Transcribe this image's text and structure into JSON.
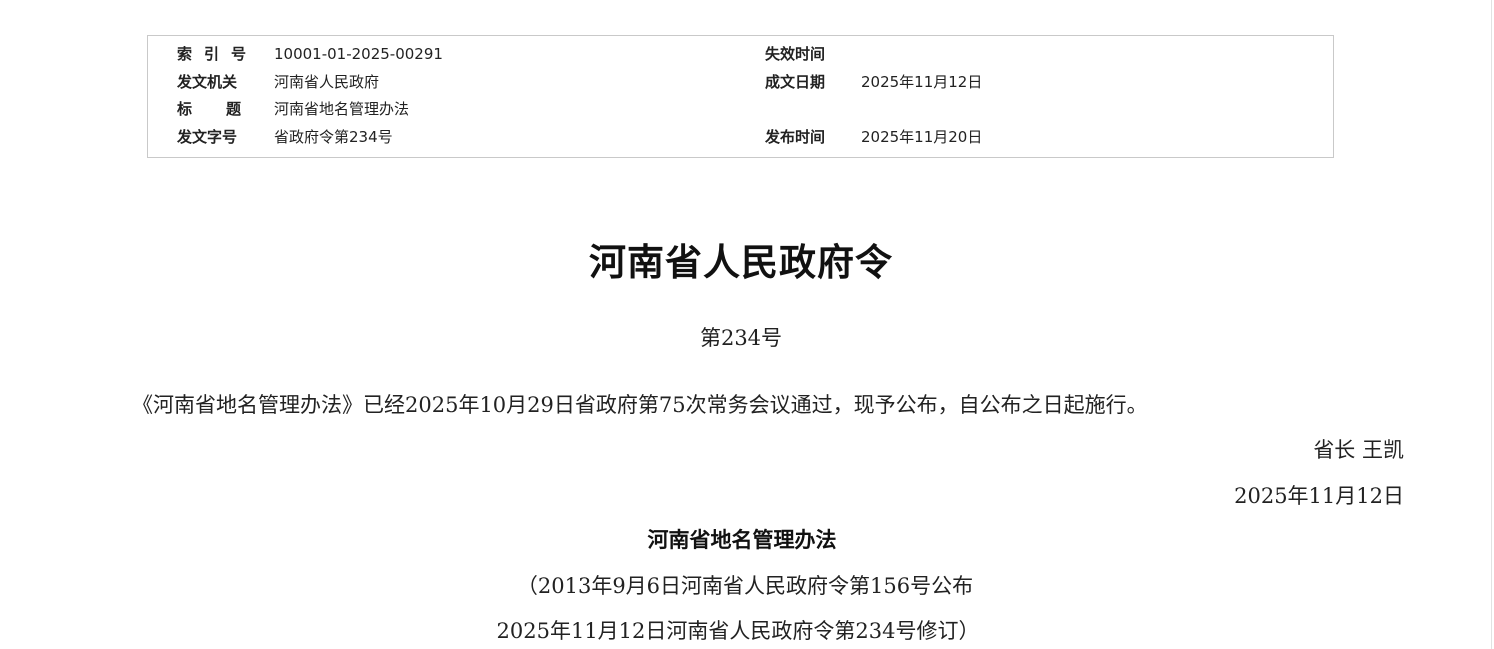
{
  "metadata": {
    "index_no": {
      "label": "索引号",
      "value": "10001-01-2025-00291"
    },
    "issuer": {
      "label": "发文机关",
      "value": "河南省人民政府"
    },
    "title": {
      "label": "标题",
      "value": "河南省地名管理办法"
    },
    "doc_no": {
      "label": "发文字号",
      "value": "省政府令第234号"
    },
    "expiry": {
      "label": "失效时间",
      "value": ""
    },
    "written_date": {
      "label": "成文日期",
      "value": "2025年11月12日"
    },
    "publish_date": {
      "label": "发布时间",
      "value": "2025年11月20日"
    }
  },
  "document": {
    "title": "河南省人民政府令",
    "number": "第234号",
    "body": "《河南省地名管理办法》已经2025年10月29日省政府第75次常务会议通过，现予公布，自公布之日起施行。",
    "signer": "省长  王凯",
    "sign_date": "2025年11月12日",
    "regulation_title": "河南省地名管理办法",
    "history_line_1": "（2013年9月6日河南省人民政府令第156号公布",
    "history_line_2": "2025年11月12日河南省人民政府令第234号修订）"
  }
}
